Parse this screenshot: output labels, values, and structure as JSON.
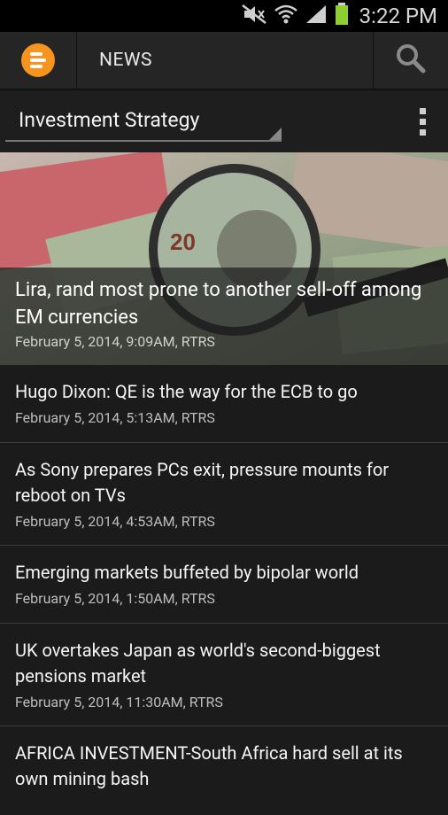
{
  "status_bar": {
    "time": "3:22 PM",
    "icons": [
      "mute-icon",
      "wifi-icon",
      "signal-icon",
      "battery-icon"
    ]
  },
  "action_bar": {
    "title": "NEWS",
    "logo_color": "#f7941d",
    "icons": [
      "app-logo-icon",
      "search-icon"
    ]
  },
  "category": {
    "selected": "Investment Strategy",
    "menu_icon": "overflow-menu-icon"
  },
  "hero": {
    "headline": "Lira, rand most prone to another sell-off among EM currencies",
    "meta": "February 5, 2014, 9:09AM, RTRS"
  },
  "articles": [
    {
      "headline": "Hugo Dixon: QE is the way for the ECB to go",
      "meta": "February 5, 2014, 5:13AM, RTRS"
    },
    {
      "headline": "As Sony prepares PCs exit, pressure mounts for reboot on TVs",
      "meta": "February 5, 2014, 4:53AM, RTRS"
    },
    {
      "headline": "Emerging markets buffeted by bipolar world",
      "meta": "February 5, 2014, 1:50AM, RTRS"
    },
    {
      "headline": "UK overtakes Japan as world's second-biggest pensions market",
      "meta": "February 5, 2014, 11:30AM, RTRS"
    },
    {
      "headline": "AFRICA INVESTMENT-South Africa hard sell at its own mining bash",
      "meta": ""
    }
  ]
}
